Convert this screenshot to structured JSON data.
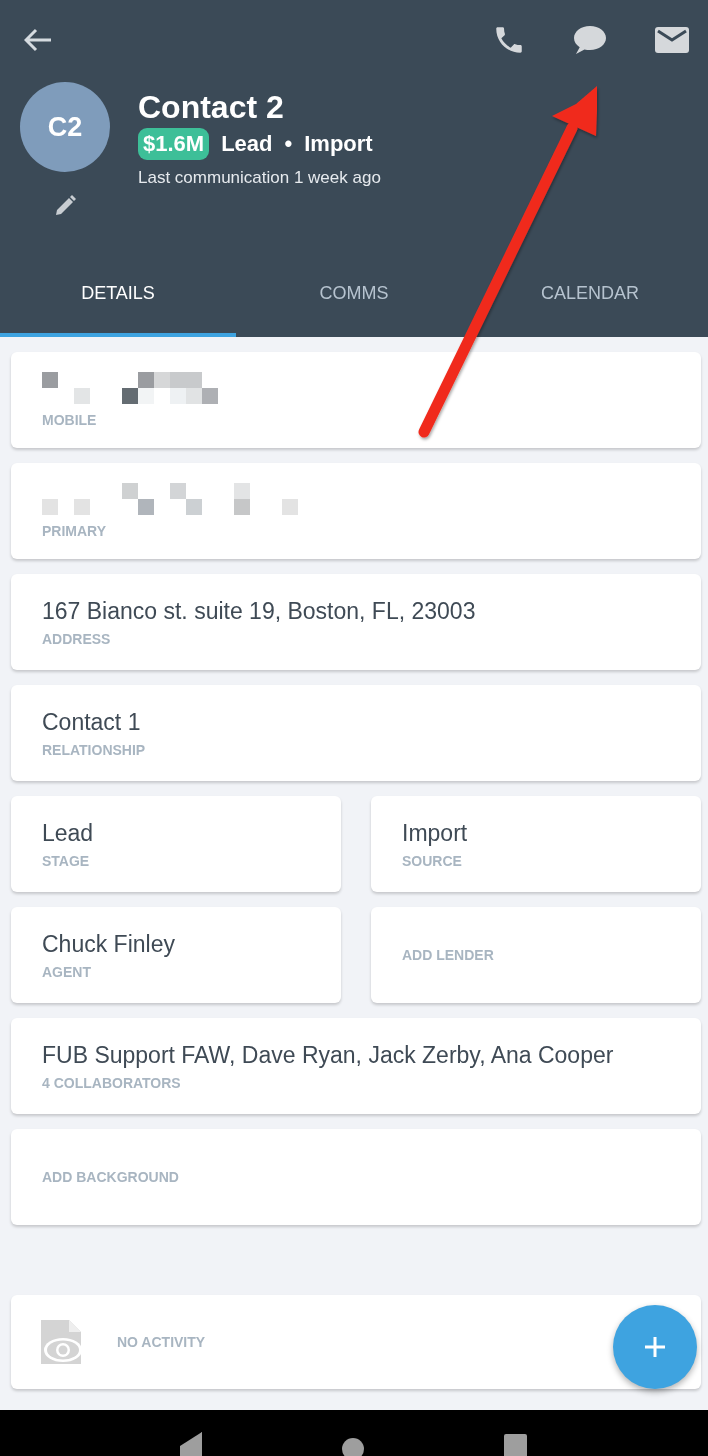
{
  "header": {
    "initials": "C2",
    "name": "Contact 2",
    "price": "$1.6M",
    "stage": "Lead",
    "separator": "•",
    "source": "Import",
    "last_communication": "Last communication 1 week ago"
  },
  "tabs": [
    {
      "label": "DETAILS",
      "selected": true
    },
    {
      "label": "COMMS",
      "selected": false
    },
    {
      "label": "CALENDAR",
      "selected": false
    }
  ],
  "fields": [
    [
      {
        "kind": "redacted",
        "label": "MOBILE"
      }
    ],
    [
      {
        "kind": "redacted",
        "label": "PRIMARY"
      }
    ],
    [
      {
        "kind": "value",
        "value": "167 Bianco st. suite 19, Boston, FL, 23003",
        "label": "ADDRESS"
      }
    ],
    [
      {
        "kind": "value",
        "value": "Contact 1",
        "label": "RELATIONSHIP"
      }
    ],
    [
      {
        "kind": "value",
        "value": "Lead",
        "label": "STAGE"
      },
      {
        "kind": "value",
        "value": "Import",
        "label": "SOURCE"
      }
    ],
    [
      {
        "kind": "value",
        "value": "Chuck Finley",
        "label": "AGENT"
      },
      {
        "kind": "action",
        "label": "ADD LENDER"
      }
    ],
    [
      {
        "kind": "value",
        "value": "FUB Support FAW, Dave Ryan, Jack Zerby, Ana Cooper",
        "label": "4 COLLABORATORS"
      }
    ],
    [
      {
        "kind": "action",
        "label": "ADD BACKGROUND"
      }
    ]
  ],
  "activity": {
    "label": "NO ACTIVITY"
  }
}
